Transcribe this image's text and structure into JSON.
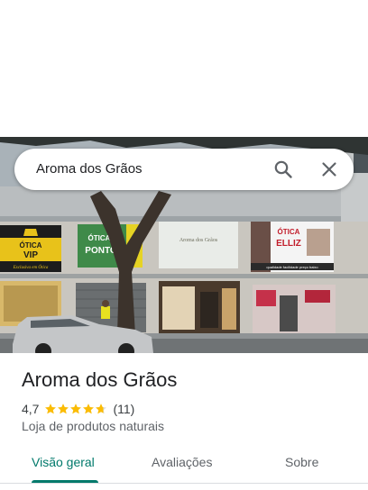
{
  "search": {
    "query": "Aroma dos Grãos",
    "icons": [
      "search-icon",
      "close-icon"
    ]
  },
  "photo": {
    "signs": {
      "vip_line1": "ÓTICA",
      "vip_line2": "VIP",
      "vip_tagline": "Exclusiva em Ótica",
      "ponto_line1": "ÓTICA",
      "ponto_line2": "PONTO",
      "aroma_sign": "Aroma dos Grãos",
      "elliz_line1": "ÓTICA",
      "elliz_line2": "ELLIZ",
      "elliz_strip": "qualidade   facilidade   preço baixo"
    }
  },
  "place": {
    "name": "Aroma dos Grãos",
    "rating": "4,7",
    "stars": 4.7,
    "reviews": "(11)",
    "category": "Loja de produtos naturais"
  },
  "tabs": [
    {
      "label": "Visão geral",
      "active": true
    },
    {
      "label": "Avaliações",
      "active": false
    },
    {
      "label": "Sobre",
      "active": false
    }
  ],
  "colors": {
    "accent": "#00796b",
    "star": "#fbbc04"
  }
}
